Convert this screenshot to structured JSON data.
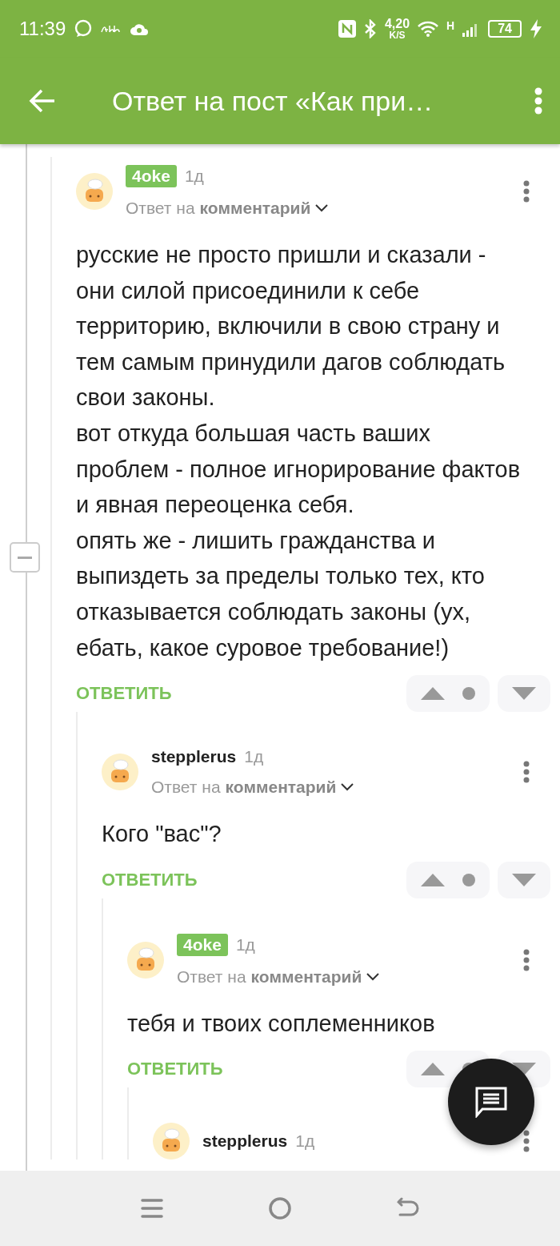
{
  "status_bar": {
    "time": "11:39",
    "net_speed": "4,20",
    "net_unit": "K/S",
    "network_type": "H",
    "battery": "74"
  },
  "header": {
    "title": "Ответ на пост «Как при…"
  },
  "comments": [
    {
      "author": "4oke",
      "highlighted": true,
      "time": "1д",
      "reply_prefix": "Ответ на",
      "reply_target": "комментарий",
      "body": [
        "русские не просто пришли и сказали - они силой присоединили к себе территорию, включили в свою страну и тем самым принудили дагов соблюдать свои законы.",
        "вот откуда большая часть ваших проблем - полное игнорирование фактов и явная переоценка себя.",
        "опять же - лишить гражданства и выпиздеть за пределы только тех, кто отказывается соблюдать законы (ух, ебать, какое суровое требование!)"
      ],
      "reply_button": "ОТВЕТИТЬ",
      "children": [
        {
          "author": "stepplerus",
          "highlighted": false,
          "time": "1д",
          "reply_prefix": "Ответ на",
          "reply_target": "комментарий",
          "body": [
            "Кого \"вас\"?"
          ],
          "reply_button": "ОТВЕТИТЬ",
          "children": [
            {
              "author": "4oke",
              "highlighted": true,
              "time": "1д",
              "reply_prefix": "Ответ на",
              "reply_target": "комментарий",
              "body": [
                "тебя и твоих соплеменников"
              ],
              "reply_button": "ОТВЕТИТЬ",
              "children": [
                {
                  "author": "stepplerus",
                  "highlighted": false,
                  "time": "1д"
                }
              ]
            }
          ]
        }
      ]
    }
  ]
}
